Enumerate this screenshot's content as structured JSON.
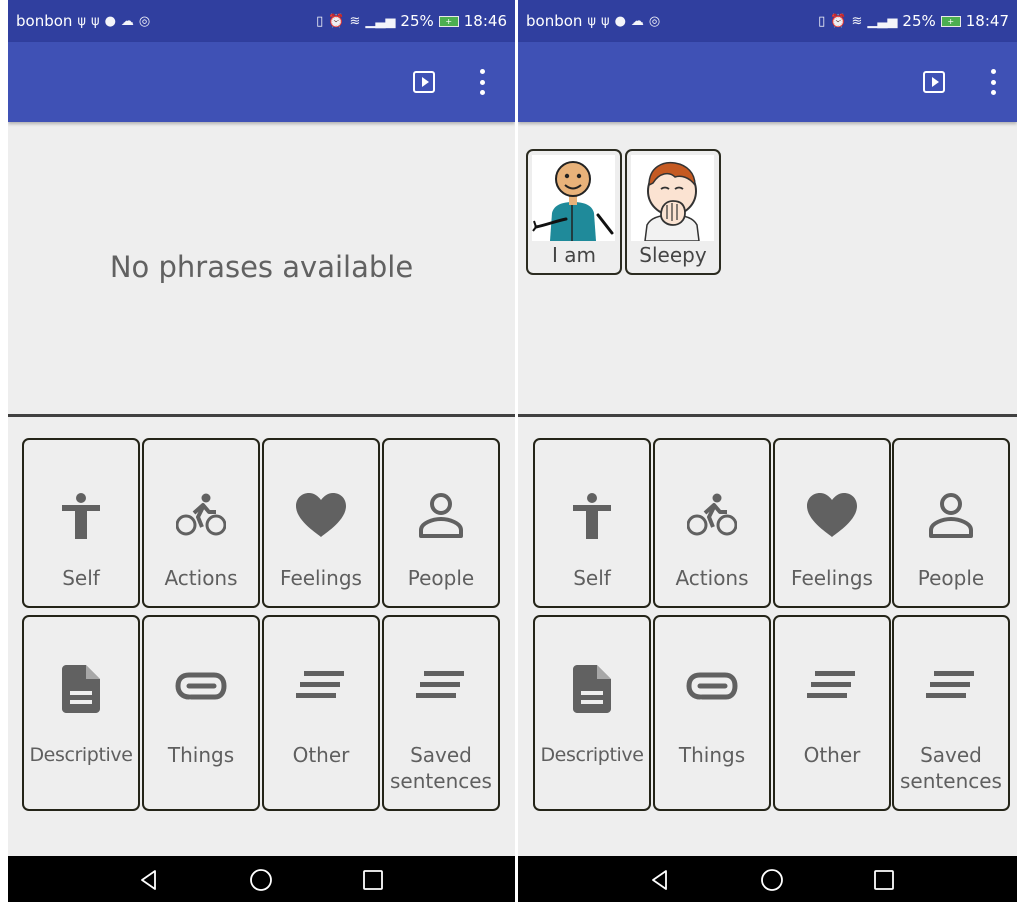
{
  "screens": [
    {
      "status": {
        "carrier": "bonbon",
        "left_icons": [
          "usb-icon",
          "usb-icon",
          "messenger-icon",
          "cloud-icon",
          "instagram-icon"
        ],
        "right_icons": [
          "vibrate-icon",
          "alarm-icon",
          "wifi-icon",
          "signal-icon"
        ],
        "battery": "25%",
        "time": "18:46"
      },
      "appbar": {
        "icons": [
          "play-icon",
          "overflow-menu-icon"
        ]
      },
      "phrases": {
        "empty_message": "No phrases available",
        "items": []
      },
      "categories": [
        {
          "label": "Self",
          "icon": "person-icon"
        },
        {
          "label": "Actions",
          "icon": "bike-icon"
        },
        {
          "label": "Feelings",
          "icon": "heart-icon"
        },
        {
          "label": "People",
          "icon": "account-icon"
        },
        {
          "label": "Descriptive",
          "icon": "document-icon"
        },
        {
          "label": "Things",
          "icon": "paperclip-icon"
        },
        {
          "label": "Other",
          "icon": "text-lines-icon"
        },
        {
          "label": "Saved sentences",
          "icon": "text-lines-icon"
        }
      ],
      "nav": {
        "icons": [
          "back-icon",
          "home-icon",
          "recents-icon"
        ]
      }
    },
    {
      "status": {
        "carrier": "bonbon",
        "left_icons": [
          "usb-icon",
          "usb-icon",
          "messenger-icon",
          "cloud-icon",
          "instagram-icon"
        ],
        "right_icons": [
          "vibrate-icon",
          "alarm-icon",
          "wifi-icon",
          "signal-icon"
        ],
        "battery": "25%",
        "time": "18:47"
      },
      "appbar": {
        "icons": [
          "play-icon",
          "overflow-menu-icon"
        ]
      },
      "phrases": {
        "empty_message": "",
        "items": [
          {
            "label": "I am",
            "icon": "boy-self-pictogram"
          },
          {
            "label": "Sleepy",
            "icon": "yawning-boy-pictogram"
          }
        ]
      },
      "categories": [
        {
          "label": "Self",
          "icon": "person-icon"
        },
        {
          "label": "Actions",
          "icon": "bike-icon"
        },
        {
          "label": "Feelings",
          "icon": "heart-icon"
        },
        {
          "label": "People",
          "icon": "account-icon"
        },
        {
          "label": "Descriptive",
          "icon": "document-icon"
        },
        {
          "label": "Things",
          "icon": "paperclip-icon"
        },
        {
          "label": "Other",
          "icon": "text-lines-icon"
        },
        {
          "label": "Saved sentences",
          "icon": "text-lines-icon"
        }
      ],
      "nav": {
        "icons": [
          "back-icon",
          "home-icon",
          "recents-icon"
        ]
      }
    }
  ],
  "colors": {
    "status_bar": "#303f9f",
    "app_bar": "#3f51b5",
    "background": "#eeeeee",
    "icon_grey": "#616161",
    "battery_green": "#4caf50"
  }
}
